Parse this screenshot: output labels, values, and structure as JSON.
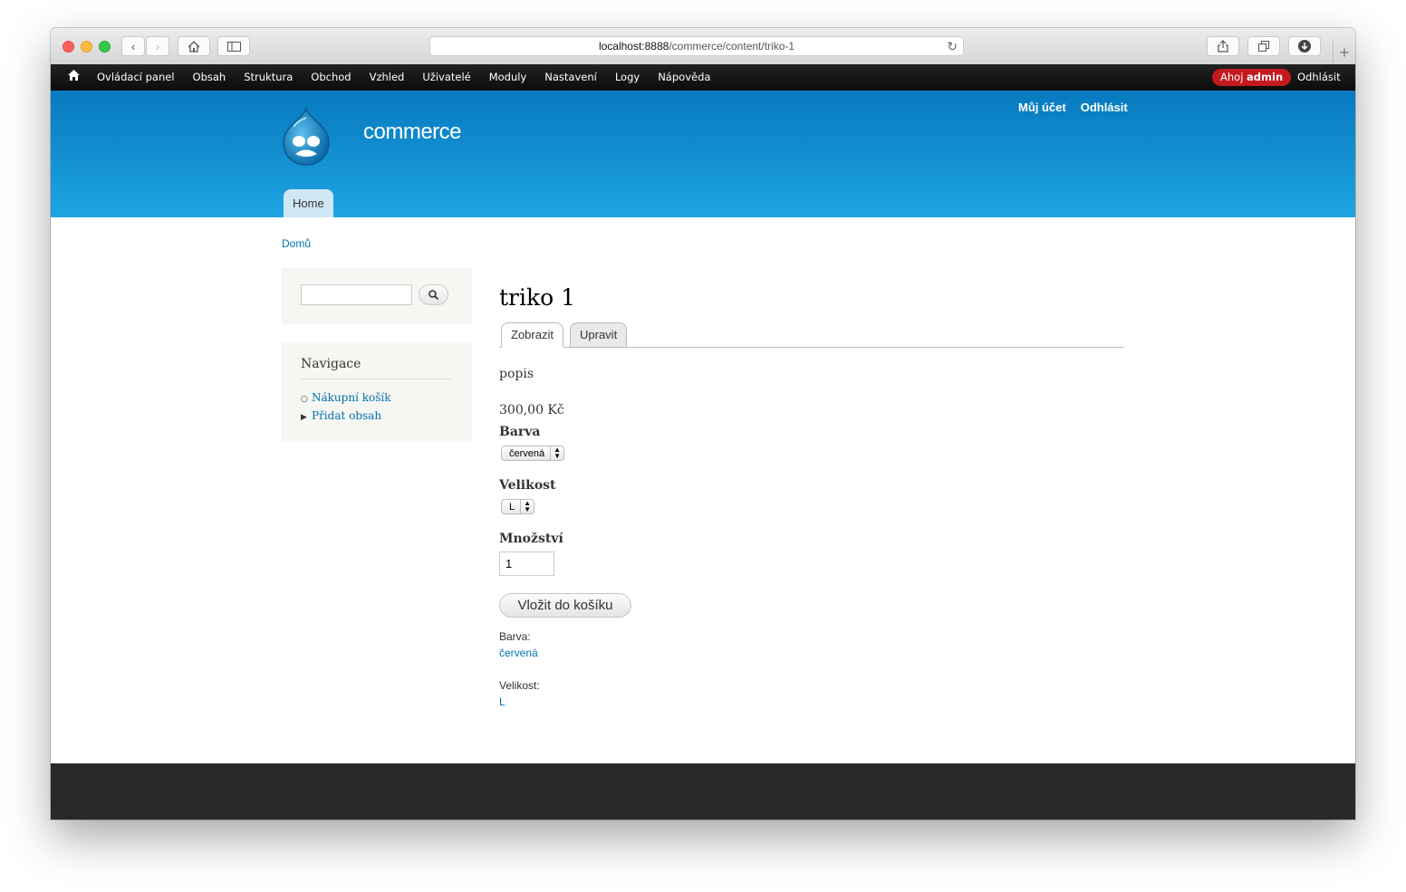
{
  "browser": {
    "url_host": "localhost:8888",
    "url_path": "/commerce/content/triko-1"
  },
  "admin_toolbar": {
    "items": [
      "Ovládací panel",
      "Obsah",
      "Struktura",
      "Obchod",
      "Vzhled",
      "Uživatelé",
      "Moduly",
      "Nastavení",
      "Logy",
      "Nápověda"
    ],
    "greeting": "Ahoj",
    "username": "admin",
    "logout": "Odhlásit"
  },
  "header": {
    "site_name": "commerce",
    "secondary_menu": [
      "Můj účet",
      "Odhlásit"
    ],
    "main_menu_home": "Home"
  },
  "breadcrumb": "Domů",
  "sidebar": {
    "search_value": "",
    "navigation_title": "Navigace",
    "navigation_items": [
      "Nákupní košík",
      "Přidat obsah"
    ]
  },
  "content": {
    "title": "triko 1",
    "tabs": [
      "Zobrazit",
      "Upravit"
    ],
    "description": "popis",
    "price": "300,00 Kč",
    "color_label": "Barva",
    "color_selected": "červená",
    "size_label": "Velikost",
    "size_selected": "L",
    "quantity_label": "Množství",
    "quantity_value": "1",
    "add_to_cart": "Vložit do košíku",
    "attr_color_label": "Barva:",
    "attr_color_value": "červená",
    "attr_size_label": "Velikost:",
    "attr_size_value": "L"
  }
}
